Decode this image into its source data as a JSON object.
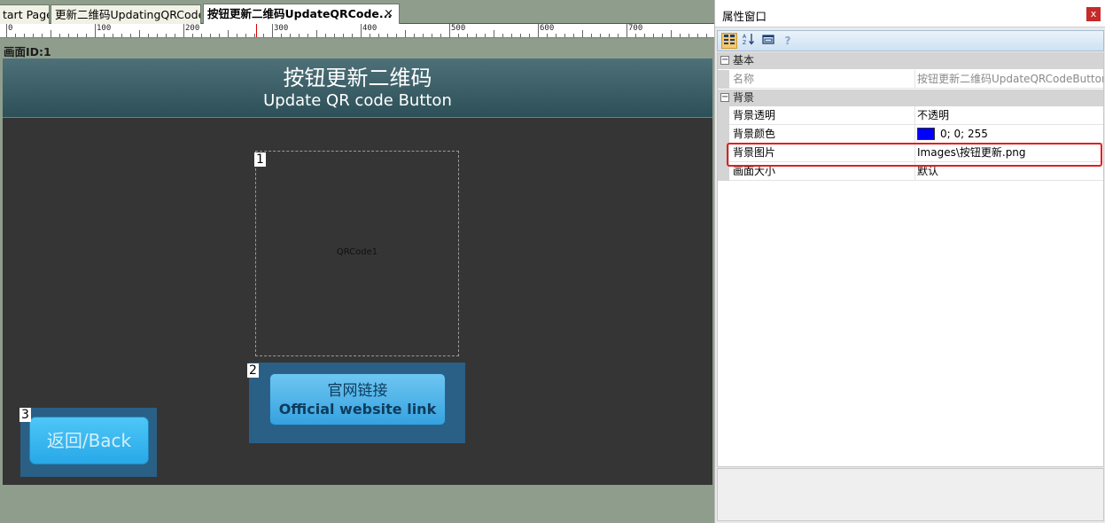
{
  "tabs": [
    {
      "label": "tart Page"
    },
    {
      "label": "更新二维码UpdatingQRCode"
    },
    {
      "label": "按钮更新二维码UpdateQRCode...",
      "close": "×"
    }
  ],
  "ruler": {
    "labels": [
      "0",
      "100",
      "200",
      "300",
      "400",
      "500",
      "600",
      "700"
    ]
  },
  "screen": {
    "label": "画面ID:1",
    "header_cn": "按钮更新二维码",
    "header_en": "Update QR code Button",
    "qr_label": "QRCode1",
    "indices": [
      "1",
      "2",
      "3"
    ],
    "link_cn": "官网链接",
    "link_en": "Official website link",
    "back_label": "返回/Back"
  },
  "properties": {
    "title": "属性窗口",
    "close": "x",
    "toolbar_help": "?",
    "categories": [
      {
        "label": "基本",
        "toggle": "−"
      },
      {
        "label": "背景",
        "toggle": "−"
      }
    ],
    "rows": [
      {
        "key": "名称",
        "value": "按钮更新二维码UpdateQRCodeButton"
      },
      {
        "key": "背景透明",
        "value": "不透明"
      },
      {
        "key": "背景颜色",
        "value": "0; 0; 255",
        "color": "#0000ff"
      },
      {
        "key": "背景图片",
        "value": "Images\\按钮更新.png"
      },
      {
        "key": "画面大小",
        "value": "默认"
      }
    ]
  },
  "colors": {
    "highlight": "#e02020",
    "canvas": "#353535",
    "button": "#35a2df"
  }
}
